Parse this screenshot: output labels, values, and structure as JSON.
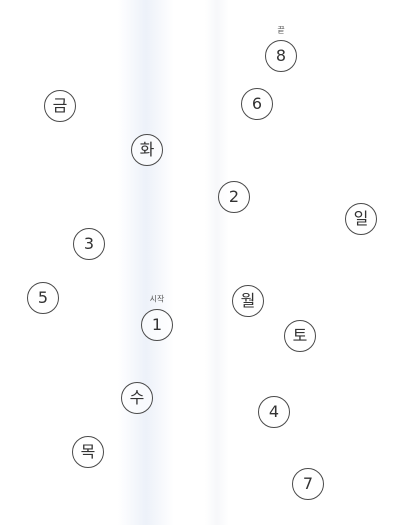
{
  "puzzle": {
    "start_caption": "시작",
    "end_caption": "끝",
    "nodes": [
      {
        "id": "8",
        "label": "8"
      },
      {
        "id": "geum",
        "label": "금"
      },
      {
        "id": "6",
        "label": "6"
      },
      {
        "id": "hwa",
        "label": "화"
      },
      {
        "id": "2",
        "label": "2"
      },
      {
        "id": "il",
        "label": "일"
      },
      {
        "id": "3",
        "label": "3"
      },
      {
        "id": "5",
        "label": "5"
      },
      {
        "id": "wol",
        "label": "월"
      },
      {
        "id": "1",
        "label": "1"
      },
      {
        "id": "to",
        "label": "토"
      },
      {
        "id": "su",
        "label": "수"
      },
      {
        "id": "4",
        "label": "4"
      },
      {
        "id": "mok",
        "label": "목"
      },
      {
        "id": "7",
        "label": "7"
      }
    ]
  },
  "colors": {
    "background": "#ffffff",
    "circle_stroke": "#4a4a4a",
    "text": "#333333"
  }
}
